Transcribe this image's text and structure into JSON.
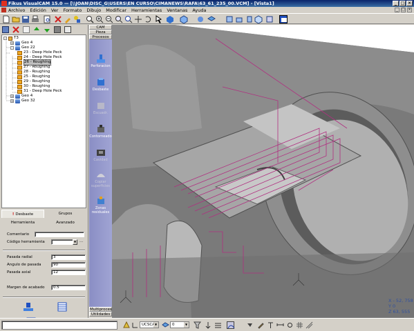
{
  "window": {
    "title": "Fikus VisualCAM 15.0 — [\\\\JOAN\\DISC_G\\USERS\\EN CURSO\\CIMANEWS\\RAFA\\63_61_235_00.VCM] - [Vista1]"
  },
  "menu": [
    "Archivo",
    "Edición",
    "Ver",
    "Formato",
    "Dibujo",
    "Modificar",
    "Herramientas",
    "Ventanas",
    "Ayuda"
  ],
  "tree": {
    "root": "T3",
    "items": [
      {
        "label": "Geo 4",
        "level": 1,
        "icon": "geo",
        "expander": "+"
      },
      {
        "label": "Geo 22",
        "level": 1,
        "icon": "geo",
        "expander": "-"
      },
      {
        "label": "23 - Deep Hole Peck",
        "level": 2,
        "icon": "op"
      },
      {
        "label": "24 - Deep Hole Peck",
        "level": 2,
        "icon": "op"
      },
      {
        "label": "26 - Roughing",
        "level": 2,
        "icon": "op",
        "selected": true
      },
      {
        "label": "27 - Roughing",
        "level": 2,
        "icon": "op"
      },
      {
        "label": "28 - Roughing",
        "level": 2,
        "icon": "op"
      },
      {
        "label": "25 - Roughing",
        "level": 2,
        "icon": "op"
      },
      {
        "label": "29 - Roughing",
        "level": 2,
        "icon": "op"
      },
      {
        "label": "30 - Roughing",
        "level": 2,
        "icon": "op"
      },
      {
        "label": "31 - Deep Hole Peck",
        "level": 2,
        "icon": "op"
      },
      {
        "label": "Geo 4",
        "level": 1,
        "icon": "geo",
        "expander": "+"
      },
      {
        "label": "Geo 32",
        "level": 1,
        "icon": "geo",
        "expander": "+"
      }
    ]
  },
  "tabs": {
    "desbaste": "Desbaste",
    "grupos": "Grupos",
    "herramienta": "Herramienta",
    "avanzado": "Avanzado"
  },
  "form": {
    "comentario_label": "Comentario",
    "comentario_value": "",
    "codigo_label": "Código herramienta",
    "codigo_value": "",
    "codigo_dots": "...",
    "pasada_radial_label": "Pasada radial",
    "pasada_radial_value": "3",
    "angulo_label": "Angulo de pasada",
    "angulo_value": "90",
    "pasada_axial_label": "Pasada axial",
    "pasada_axial_value": "12",
    "margen_label": "Margen de acabado",
    "margen_value": "0.5"
  },
  "ops_panel": {
    "headers": [
      "CAM",
      "Pieza",
      "Procesos"
    ],
    "items": [
      {
        "label": "Perforacion",
        "enabled": true
      },
      {
        "label": "Desbaste",
        "enabled": true
      },
      {
        "label": "Escuadr.",
        "enabled": false
      },
      {
        "label": "Contorneado",
        "enabled": true
      },
      {
        "label": "Cavidad",
        "enabled": false
      },
      {
        "label": "Copiar superficies",
        "enabled": false
      },
      {
        "label": "Zonas residuales",
        "enabled": true
      }
    ],
    "footers": [
      "Multiprocesos",
      "Utilidades"
    ]
  },
  "coords": {
    "x": "X - 52, 758",
    "y": "Y  0",
    "z": "Z  63, 555"
  },
  "statusbar": {
    "ucs": "UCSCAM",
    "layer": "0"
  },
  "colors": {
    "title_bar": "#0a246a",
    "ops_panel": "#9296cc",
    "part_dark": "#707070",
    "part_light": "#a8a8a8",
    "toolpath": "#b03080"
  }
}
